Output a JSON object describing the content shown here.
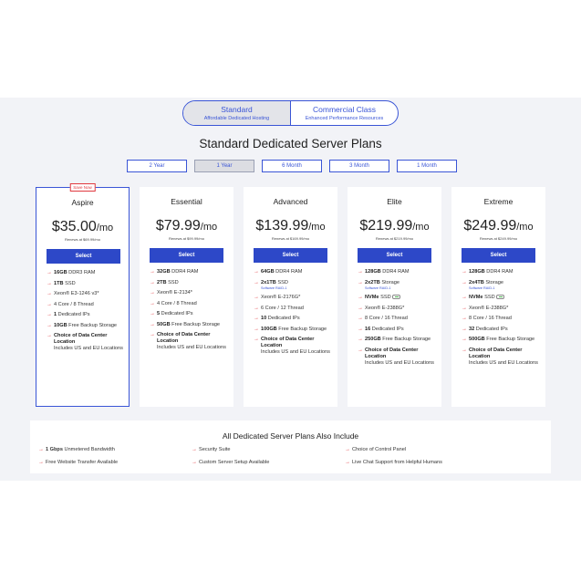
{
  "plan_toggle": [
    {
      "label": "Standard",
      "sub": "Affordable Dedicated Hosting",
      "active": true
    },
    {
      "label": "Commercial Class",
      "sub": "Enhanced Performance Resources",
      "active": false
    }
  ],
  "page_title": "Standard Dedicated Server Plans",
  "terms": [
    {
      "label": "2 Year",
      "active": false
    },
    {
      "label": "1 Year",
      "active": true
    },
    {
      "label": "6 Month",
      "active": false
    },
    {
      "label": "3 Month",
      "active": false
    },
    {
      "label": "1 Month",
      "active": false
    }
  ],
  "select_label": "Select",
  "plans": [
    {
      "name": "Aspire",
      "badge": "Save Now",
      "featured": true,
      "price": "$35.00",
      "per": "/mo",
      "renews": "Renews at $69.99/mo",
      "features": [
        {
          "bold": "16GB",
          "text": " DDR3 RAM"
        },
        {
          "bold": "1TB",
          "text": " SSD"
        },
        {
          "bold": "",
          "text": "Xeon® E3-1246 v3*"
        },
        {
          "bold": "",
          "text": "4 Core / 8 Thread"
        },
        {
          "bold": "1",
          "text": " Dedicated IPs"
        },
        {
          "bold": "10GB",
          "text": " Free Backup Storage"
        },
        {
          "bold": "Choice of Data Center Location",
          "text": "",
          "after": "Includes US and EU Locations"
        }
      ]
    },
    {
      "name": "Essential",
      "badge": "",
      "featured": false,
      "price": "$79.99",
      "per": "/mo",
      "renews": "Renews at $99.99/mo",
      "features": [
        {
          "bold": "32GB",
          "text": " DDR4 RAM"
        },
        {
          "bold": "2TB",
          "text": " SSD"
        },
        {
          "bold": "",
          "text": "Xeon® E-2134*"
        },
        {
          "bold": "",
          "text": "4 Core / 8 Thread"
        },
        {
          "bold": "5",
          "text": " Dedicated IPs"
        },
        {
          "bold": "50GB",
          "text": " Free Backup Storage"
        },
        {
          "bold": "Choice of Data Center Location",
          "text": "",
          "after": "Includes US and EU Locations"
        }
      ]
    },
    {
      "name": "Advanced",
      "badge": "",
      "featured": false,
      "price": "$139.99",
      "per": "/mo",
      "renews": "Renews at $169.99/mo",
      "features": [
        {
          "bold": "64GB",
          "text": " DDR4 RAM"
        },
        {
          "bold": "2x1TB",
          "text": " SSD",
          "sub": "Software RAID-1"
        },
        {
          "bold": "",
          "text": "Xeon® E-2176G*"
        },
        {
          "bold": "",
          "text": "6 Core / 12 Thread"
        },
        {
          "bold": "10",
          "text": " Dedicated IPs"
        },
        {
          "bold": "100GB",
          "text": " Free Backup Storage"
        },
        {
          "bold": "Choice of Data Center Location",
          "text": "",
          "after": "Includes US and EU Locations"
        }
      ]
    },
    {
      "name": "Elite",
      "badge": "",
      "featured": false,
      "price": "$219.99",
      "per": "/mo",
      "renews": "Renews at $219.99/mo",
      "features": [
        {
          "bold": "128GB",
          "text": " DDR4 RAM"
        },
        {
          "bold": "2x2TB",
          "text": " Storage",
          "sub": "Software RAID-1"
        },
        {
          "bold": "NVMe",
          "text": " SSD",
          "nvme": true
        },
        {
          "bold": "",
          "text": "Xeon® E-2388G*"
        },
        {
          "bold": "",
          "text": "8 Core / 16 Thread"
        },
        {
          "bold": "16",
          "text": " Dedicated IPs"
        },
        {
          "bold": "250GB",
          "text": " Free Backup Storage"
        },
        {
          "bold": "Choice of Data Center Location",
          "text": "",
          "after": "Includes US and EU Locations"
        }
      ]
    },
    {
      "name": "Extreme",
      "badge": "",
      "featured": false,
      "price": "$249.99",
      "per": "/mo",
      "renews": "Renews at $249.99/mo",
      "features": [
        {
          "bold": "128GB",
          "text": " DDR4 RAM"
        },
        {
          "bold": "2x4TB",
          "text": " Storage",
          "sub": "Software RAID-1"
        },
        {
          "bold": "NVMe",
          "text": " SSD",
          "nvme": true
        },
        {
          "bold": "",
          "text": "Xeon® E-2388G*"
        },
        {
          "bold": "",
          "text": "8 Core / 16 Thread"
        },
        {
          "bold": "32",
          "text": " Dedicated IPs"
        },
        {
          "bold": "500GB",
          "text": " Free Backup Storage"
        },
        {
          "bold": "Choice of Data Center Location",
          "text": "",
          "after": "Includes US and EU Locations"
        }
      ]
    }
  ],
  "includes": {
    "title": "All Dedicated Server Plans Also Include",
    "columns": [
      [
        {
          "bold": "1 Gbps",
          "text": " Unmetered Bandwidth"
        },
        {
          "bold": "",
          "text": "Free Website Transfer Available"
        }
      ],
      [
        {
          "bold": "",
          "text": "Security Suite"
        },
        {
          "bold": "",
          "text": "Custom Server Setup Available"
        }
      ],
      [
        {
          "bold": "",
          "text": "Choice of Control Panel"
        },
        {
          "bold": "",
          "text": "Live Chat Support from Helpful Humans"
        }
      ]
    ]
  },
  "colors": {
    "accent": "#2d48c8",
    "arrow": "#e0383e",
    "band": "#f2f3f7"
  },
  "icons": {
    "feature_bullet": "arrow-right-icon",
    "nvme": "nvme-drive-icon"
  }
}
